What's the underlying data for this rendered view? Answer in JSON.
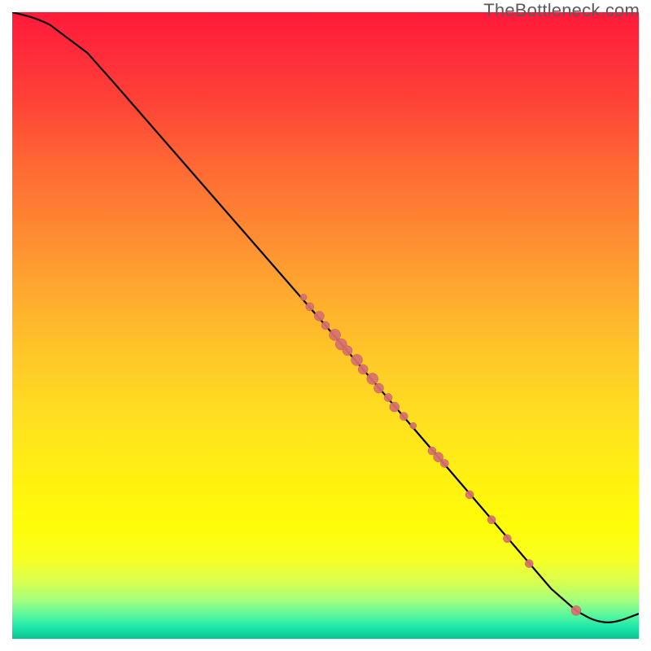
{
  "attribution": "TheBottleneck.com",
  "chart_data": {
    "type": "line",
    "title": "",
    "xlabel": "",
    "ylabel": "",
    "xlim": [
      0,
      100
    ],
    "ylim": [
      0,
      100
    ],
    "curve": [
      {
        "x": 0,
        "y": 100
      },
      {
        "x": 4,
        "y": 99
      },
      {
        "x": 8,
        "y": 97
      },
      {
        "x": 12,
        "y": 93.5
      },
      {
        "x": 16,
        "y": 89
      },
      {
        "x": 50,
        "y": 50
      },
      {
        "x": 86,
        "y": 8
      },
      {
        "x": 90,
        "y": 4.5
      },
      {
        "x": 93,
        "y": 2.8
      },
      {
        "x": 96,
        "y": 2.5
      },
      {
        "x": 100,
        "y": 4
      }
    ],
    "scatter_points": [
      {
        "x": 46.5,
        "y": 54.5,
        "r": 4
      },
      {
        "x": 47.5,
        "y": 53,
        "r": 5
      },
      {
        "x": 49,
        "y": 51.5,
        "r": 6
      },
      {
        "x": 50,
        "y": 50,
        "r": 5
      },
      {
        "x": 51.5,
        "y": 48.5,
        "r": 7
      },
      {
        "x": 52.5,
        "y": 47,
        "r": 7
      },
      {
        "x": 53.5,
        "y": 46,
        "r": 6
      },
      {
        "x": 55,
        "y": 44.5,
        "r": 7
      },
      {
        "x": 56,
        "y": 43,
        "r": 6
      },
      {
        "x": 57.5,
        "y": 41.5,
        "r": 7
      },
      {
        "x": 58.5,
        "y": 40,
        "r": 6
      },
      {
        "x": 60,
        "y": 38.5,
        "r": 5
      },
      {
        "x": 61,
        "y": 37,
        "r": 6
      },
      {
        "x": 62.5,
        "y": 35.5,
        "r": 5
      },
      {
        "x": 64,
        "y": 34,
        "r": 4
      },
      {
        "x": 67,
        "y": 30,
        "r": 5
      },
      {
        "x": 68,
        "y": 29,
        "r": 6
      },
      {
        "x": 69,
        "y": 28,
        "r": 5
      },
      {
        "x": 73,
        "y": 23,
        "r": 5
      },
      {
        "x": 76.5,
        "y": 19,
        "r": 5
      },
      {
        "x": 79,
        "y": 16,
        "r": 5
      },
      {
        "x": 82.5,
        "y": 12,
        "r": 5
      },
      {
        "x": 90,
        "y": 4.5,
        "r": 6
      }
    ],
    "colors": {
      "curve": "#000000",
      "point_fill": "#d87070",
      "point_stroke": "#c05858"
    }
  }
}
